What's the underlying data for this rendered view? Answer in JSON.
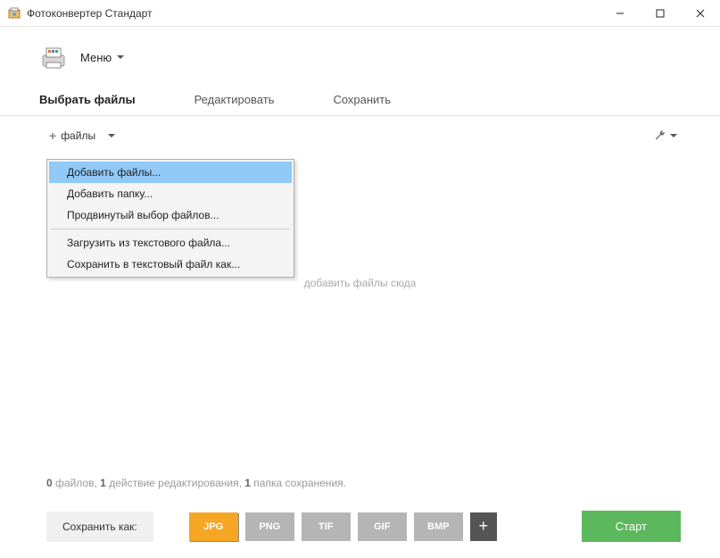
{
  "window": {
    "title": "Фотоконвертер Стандарт"
  },
  "menu": {
    "label": "Меню"
  },
  "tabs": {
    "select": "Выбрать файлы",
    "edit": "Редактировать",
    "save": "Сохранить"
  },
  "toolbar": {
    "files_label": "файлы"
  },
  "dropdown": {
    "add_files": "Добавить файлы...",
    "add_folder": "Добавить папку...",
    "advanced": "Продвинутый выбор файлов...",
    "load_txt": "Загрузить из текстового файла...",
    "save_txt": "Сохранить в текстовый файл как..."
  },
  "drop_hint": "добавить файлы сюда",
  "status": {
    "files_count": "0",
    "files_word": "файлов,",
    "edits_count": "1",
    "edits_word": "действие редактирования,",
    "folders_count": "1",
    "folders_word": "папка сохранения."
  },
  "bottom": {
    "save_as": "Сохранить как:",
    "formats": {
      "jpg": "JPG",
      "png": "PNG",
      "tif": "TIF",
      "gif": "GIF",
      "bmp": "BMP"
    },
    "start": "Старт"
  }
}
